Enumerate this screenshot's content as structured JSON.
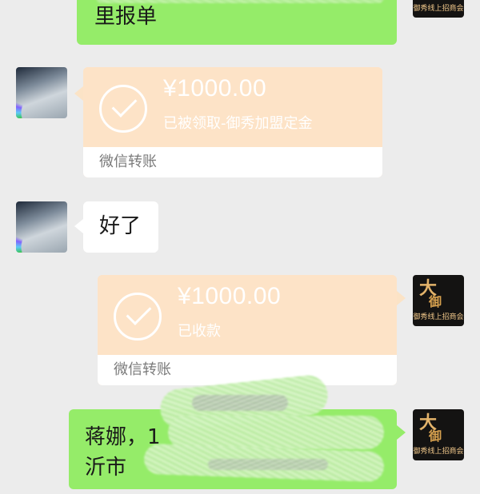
{
  "messages": [
    {
      "id": "m1",
      "sender": "me",
      "type": "text",
      "visible_text": "里报单"
    },
    {
      "id": "m2",
      "sender": "other",
      "type": "transfer",
      "amount": "¥1000.00",
      "status": "已被领取-御秀加盟定金",
      "footer": "微信转账"
    },
    {
      "id": "m3",
      "sender": "other",
      "type": "text",
      "text": "好了"
    },
    {
      "id": "m4",
      "sender": "me",
      "type": "transfer",
      "amount": "¥1000.00",
      "status": "已收款",
      "footer": "微信转账"
    },
    {
      "id": "m5",
      "sender": "me",
      "type": "text",
      "line1": "蒋娜，1",
      "line2": "沂市"
    }
  ],
  "brand_avatar": {
    "big": "大",
    "big2": "御",
    "small": "御秀线上招商会"
  },
  "colors": {
    "background": "#ececec",
    "my_bubble": "#95ec69",
    "their_bubble": "#ffffff",
    "transfer_card": "#fde3c7"
  }
}
